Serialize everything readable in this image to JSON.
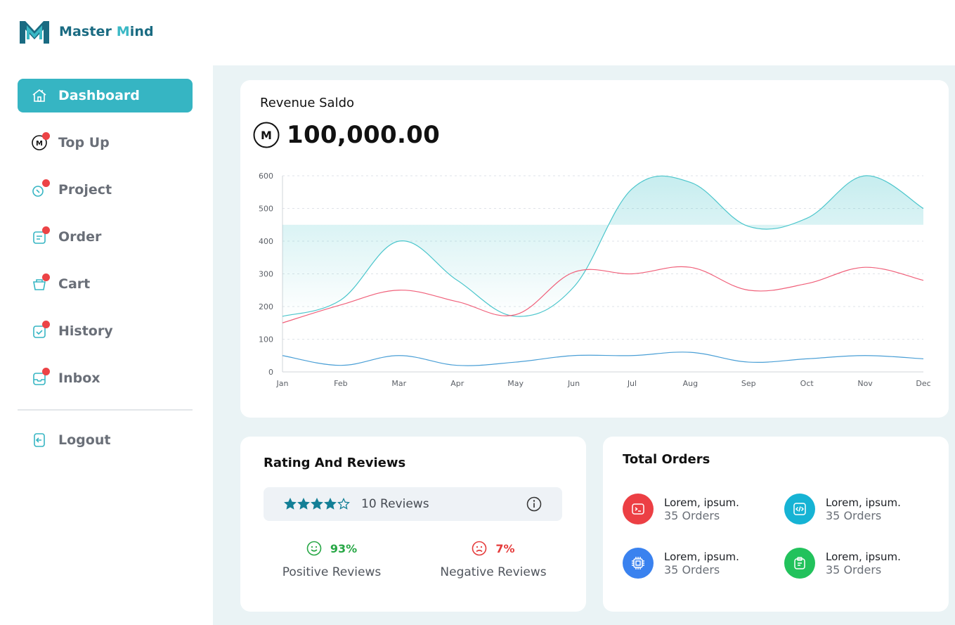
{
  "brand": {
    "name_part1": "Master ",
    "name_accent": "M",
    "name_part2": "ind",
    "color_primary": "#1a6b82",
    "color_accent": "#3ab8c5"
  },
  "sidebar": {
    "items": [
      {
        "label": "Dashboard",
        "icon": "home-icon",
        "active": true,
        "badge": false
      },
      {
        "label": "Top Up",
        "icon": "coin-icon",
        "active": false,
        "badge": true
      },
      {
        "label": "Project",
        "icon": "project-icon",
        "active": false,
        "badge": true
      },
      {
        "label": "Order",
        "icon": "order-icon",
        "active": false,
        "badge": true
      },
      {
        "label": "Cart",
        "icon": "cart-icon",
        "active": false,
        "badge": true
      },
      {
        "label": "History",
        "icon": "history-icon",
        "active": false,
        "badge": true
      },
      {
        "label": "Inbox",
        "icon": "inbox-icon",
        "active": false,
        "badge": true
      }
    ],
    "logout_label": "Logout"
  },
  "revenue": {
    "title": "Revenue Saldo",
    "amount": "100,000.00"
  },
  "chart_data": {
    "type": "line",
    "categories": [
      "Jan",
      "Feb",
      "Mar",
      "Apr",
      "May",
      "Jun",
      "Jul",
      "Aug",
      "Sep",
      "Oct",
      "Nov",
      "Dec"
    ],
    "y_ticks": [
      0,
      100,
      200,
      300,
      400,
      500,
      600
    ],
    "ylim": [
      0,
      600
    ],
    "grid": true,
    "series": [
      {
        "color": "#4cc6cc",
        "values": [
          170,
          220,
          400,
          280,
          170,
          260,
          560,
          580,
          445,
          470,
          600,
          500
        ]
      },
      {
        "color": "#f0607a",
        "values": [
          150,
          205,
          250,
          215,
          175,
          305,
          300,
          320,
          250,
          270,
          320,
          280
        ]
      },
      {
        "color": "#4a9fd6",
        "values": [
          50,
          20,
          50,
          20,
          30,
          50,
          50,
          60,
          30,
          40,
          50,
          40
        ]
      }
    ]
  },
  "rating": {
    "title": "Rating And Reviews",
    "stars": 4,
    "max_stars": 5,
    "reviews_label": "10 Reviews",
    "positive_pct": "93%",
    "positive_label": "Positive Reviews",
    "negative_pct": "7%",
    "negative_label": "Negative Reviews"
  },
  "orders": {
    "title": "Total Orders",
    "items": [
      {
        "name": "Lorem, ipsum.",
        "count": "35 Orders",
        "icon": "terminal-icon",
        "color": "#ec3f44"
      },
      {
        "name": "Lorem, ipsum.",
        "count": "35 Orders",
        "icon": "code-icon",
        "color": "#16b3d4"
      },
      {
        "name": "Lorem, ipsum.",
        "count": "35 Orders",
        "icon": "chip-icon",
        "color": "#3a82ef"
      },
      {
        "name": "Lorem, ipsum.",
        "count": "35 Orders",
        "icon": "clipboard-icon",
        "color": "#22c25c"
      }
    ]
  }
}
